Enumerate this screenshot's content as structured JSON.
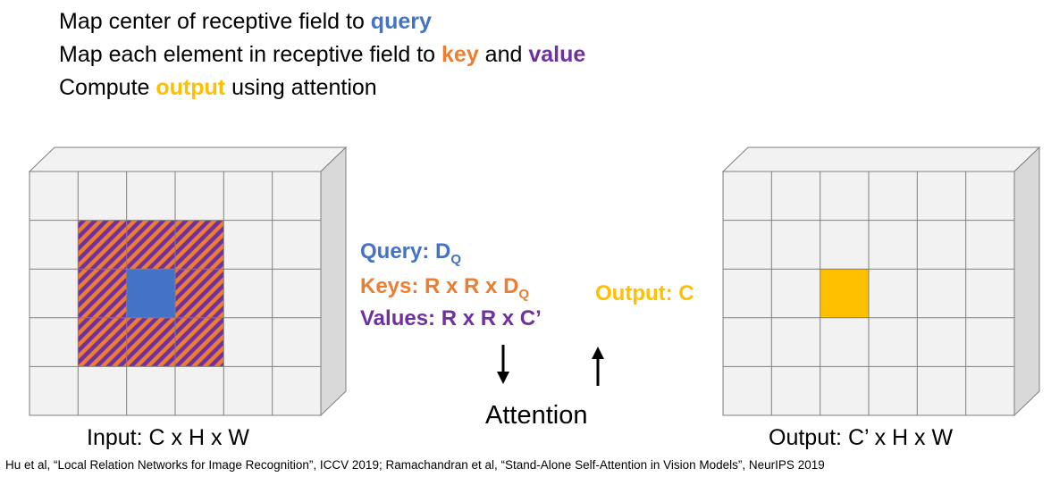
{
  "bullets": {
    "line1": {
      "text": "Map center of receptive field to ",
      "query": "query"
    },
    "line2": {
      "text": "Map each element in receptive field to ",
      "key": "key",
      "and": " and ",
      "value": "value"
    },
    "line3": {
      "text": "Compute ",
      "output": "output",
      "rest": " using attention"
    }
  },
  "middle": {
    "query": {
      "label": "Query: D",
      "sub": "Q"
    },
    "keys": {
      "label": "Keys: R x R x D",
      "sub": "Q"
    },
    "values": {
      "label": "Values: R x R x C’"
    },
    "output": {
      "label": "Output: C"
    },
    "attention": "Attention"
  },
  "input_caption": "Input: C x H x W",
  "output_caption": "Output: C’ x H x W",
  "citation": "Hu et al, “Local Relation Networks for Image Recognition”, ICCV 2019;  Ramachandran et al, “Stand-Alone Self-Attention in Vision Models”, NeurIPS 2019",
  "colors": {
    "query": "#4472C4",
    "key": "#ED7D31",
    "value": "#7030A0",
    "output": "#FFC000",
    "grid_face": "#F2F2F2",
    "grid_top": "#F2F2F2",
    "grid_side": "#D9D9D9",
    "grid_line": "#7F7F7F"
  }
}
